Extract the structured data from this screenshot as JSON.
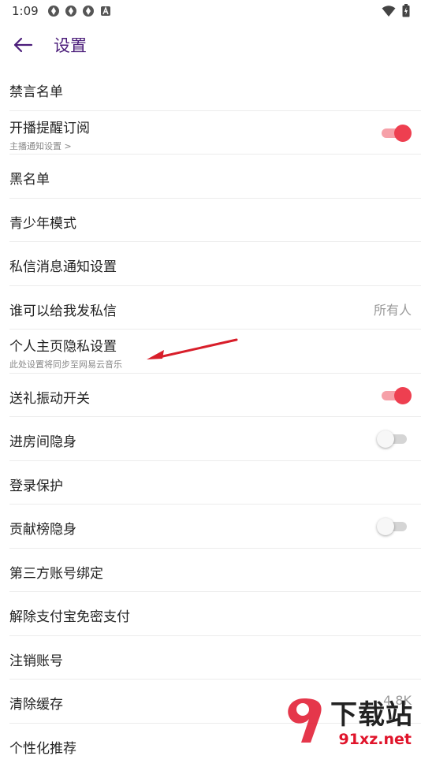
{
  "status_bar": {
    "time": "1:09",
    "icons": [
      "app-notification-icon",
      "app-notification-icon",
      "app-notification-icon",
      "a-icon"
    ],
    "right_icons": [
      "wifi-icon",
      "battery-icon"
    ]
  },
  "header": {
    "title": "设置",
    "title_color": "#4b1d7a"
  },
  "settings": [
    {
      "label": "禁言名单"
    },
    {
      "label": "开播提醒订阅",
      "sub": "主播通知设置 >",
      "toggle": true
    },
    {
      "label": "黑名单"
    },
    {
      "label": "青少年模式"
    },
    {
      "label": "私信消息通知设置"
    },
    {
      "label": "谁可以给我发私信",
      "value": "所有人"
    },
    {
      "label": "个人主页隐私设置",
      "sub": "此处设置将同步至网易云音乐"
    },
    {
      "label": "送礼振动开关",
      "toggle": true
    },
    {
      "label": "进房间隐身",
      "toggle": false
    },
    {
      "label": "登录保护"
    },
    {
      "label": "贡献榜隐身",
      "toggle": false
    },
    {
      "label": "第三方账号绑定"
    },
    {
      "label": "解除支付宝免密支付"
    },
    {
      "label": "注销账号"
    },
    {
      "label": "清除缓存",
      "value": "4.8K"
    },
    {
      "label": "个性化推荐"
    }
  ],
  "colors": {
    "toggle_on": "#ee3f50",
    "annotation_arrow": "#d81e2a"
  },
  "watermark": {
    "brand": "下载站",
    "domain": "91xz.net",
    "logo_text": "9"
  }
}
